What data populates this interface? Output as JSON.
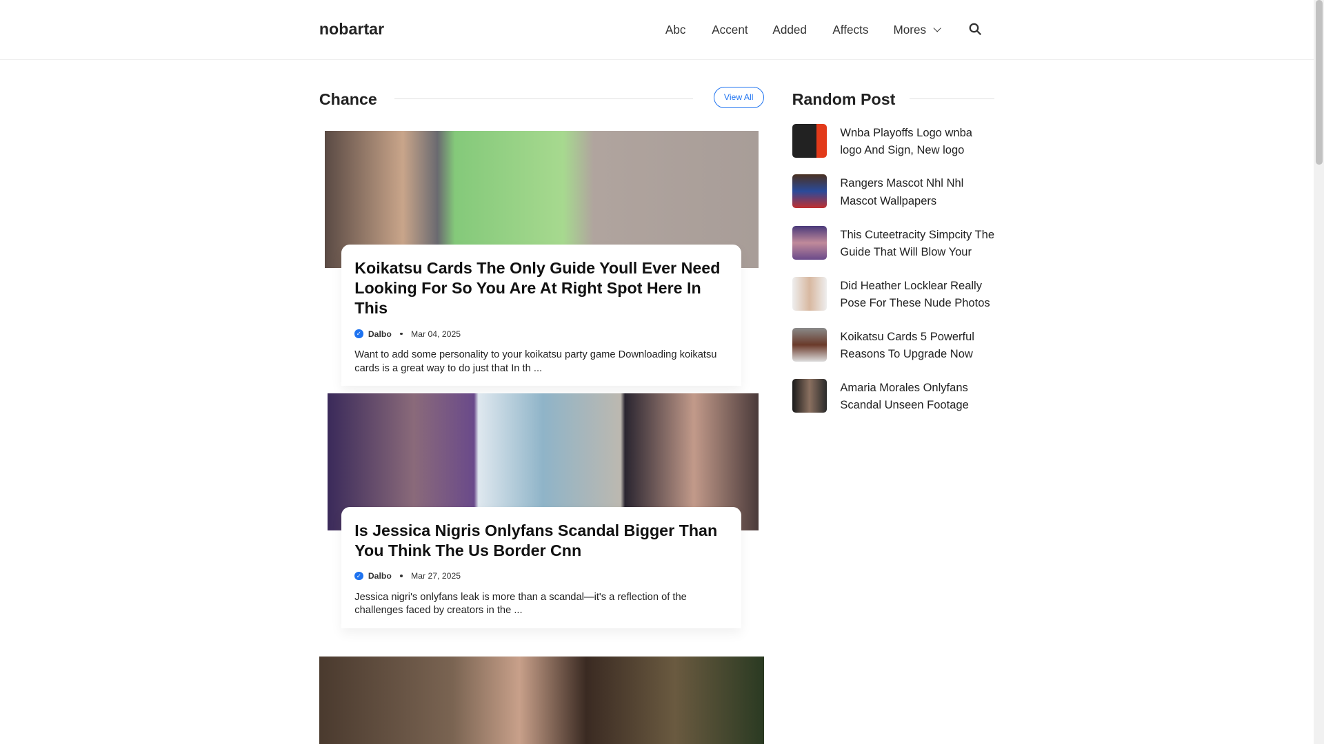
{
  "header": {
    "brand": "nobartar",
    "nav": [
      "Abc",
      "Accent",
      "Added",
      "Affects",
      "Mores"
    ],
    "search_icon": "search-icon"
  },
  "main": {
    "section_title": "Chance",
    "view_all": "View All",
    "posts": [
      {
        "title": "Koikatsu Cards The Only Guide Youll Ever Need Looking For So You Are At Right Spot Here In This",
        "author": "Dalbo",
        "date": "Mar 04, 2025",
        "excerpt": "Want to add some personality to your koikatsu party game Downloading koikatsu cards is a great way to do just that In th ..."
      },
      {
        "title": "Is Jessica Nigris Onlyfans Scandal Bigger Than You Think The Us Border Cnn",
        "author": "Dalbo",
        "date": "Mar 27, 2025",
        "excerpt": "Jessica nigri's onlyfans leak is more than a scandal—it's a reflection of the challenges faced by creators in the ..."
      }
    ]
  },
  "sidebar": {
    "title": "Random Post",
    "items": [
      "Wnba Playoffs Logo wnba logo And Sign, New logo Meaning And History PNG SVG",
      "Rangers Mascot Nhl Nhl Mascot Wallpapers",
      "This Cuteetracity Simpcity The Guide That Will Blow Your Mind",
      "Did Heather Locklear Really Pose For These Nude Photos",
      "Koikatsu Cards 5 Powerful Reasons To Upgrade Now",
      "Amaria Morales Onlyfans Scandal Unseen Footage Revealed"
    ]
  }
}
